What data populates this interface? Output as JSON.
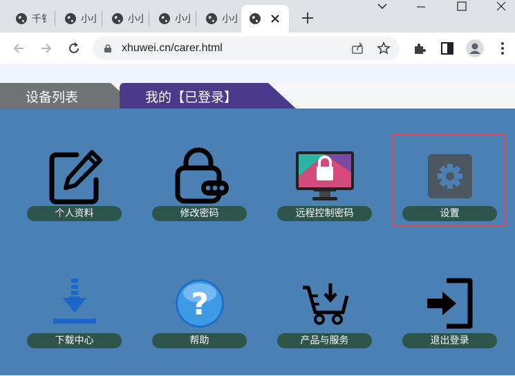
{
  "browser": {
    "tabs": [
      {
        "title": "千钅",
        "active": false
      },
      {
        "title": "小小",
        "active": false
      },
      {
        "title": "小小",
        "active": false
      },
      {
        "title": "小小",
        "active": false
      },
      {
        "title": "小小",
        "active": false
      },
      {
        "title": "",
        "active": true
      }
    ],
    "address": "xhuwei.cn/carer.html"
  },
  "page": {
    "tabs": [
      {
        "label": "设备列表",
        "selected": false
      },
      {
        "label": "我的【已登录】",
        "selected": true
      }
    ],
    "items": [
      {
        "label": "个人资料",
        "icon": "edit-icon"
      },
      {
        "label": "修改密码",
        "icon": "lock-icon"
      },
      {
        "label": "远程控制密码",
        "icon": "remote-lock-monitor-icon"
      },
      {
        "label": "设置",
        "icon": "gear-icon"
      },
      {
        "label": "下载中心",
        "icon": "download-icon"
      },
      {
        "label": "帮助",
        "icon": "help-icon"
      },
      {
        "label": "产品与服务",
        "icon": "cart-icon"
      },
      {
        "label": "退出登录",
        "icon": "logout-icon"
      }
    ]
  },
  "colors": {
    "content_bg": "#4a80b4",
    "pill_bg": "#2d5549",
    "tab_inactive": "#6f7376",
    "tab_active": "#4a3a8c",
    "highlight": "#e34553"
  }
}
